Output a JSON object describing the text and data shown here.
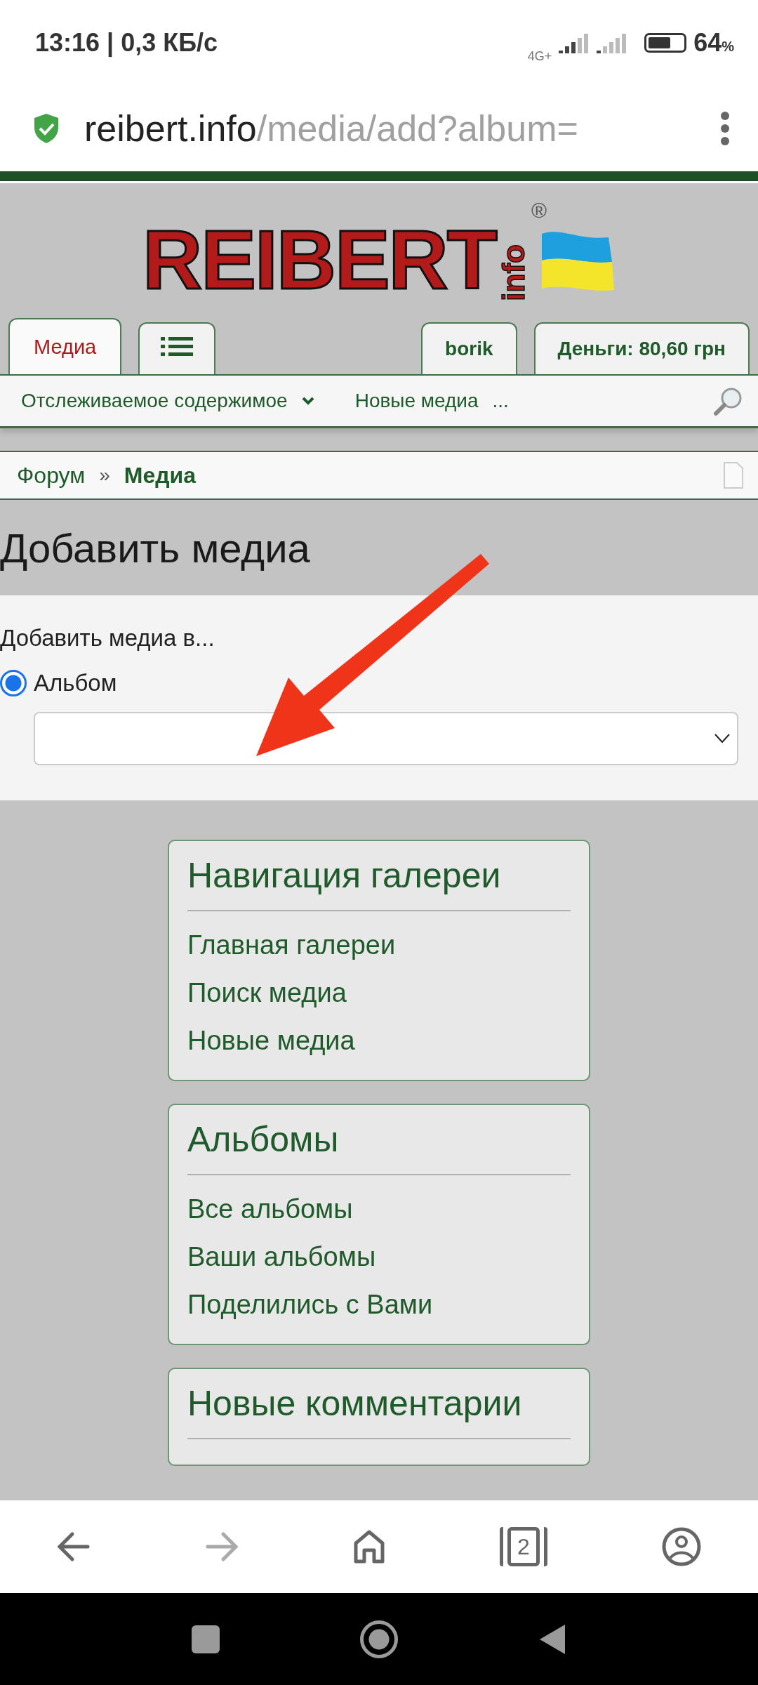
{
  "status_bar": {
    "time": "13:16 | 0,3 КБ/с",
    "network": "4G+",
    "battery": "64",
    "battery_unit": "%"
  },
  "address_bar": {
    "domain": "reibert.info",
    "path": "/media/add?album="
  },
  "logo": {
    "name": "REIBERT",
    "suffix": "info",
    "mark": "®"
  },
  "tabs": [
    {
      "label": "Медиа",
      "kind": "text",
      "selected": true
    },
    {
      "kind": "menu",
      "selected": false
    }
  ],
  "user_tabs": [
    {
      "label": "borik"
    },
    {
      "label": "Деньги: 80,60 грн"
    }
  ],
  "subnav": [
    {
      "label": "Отслеживаемое содержимое",
      "dropdown": true
    },
    {
      "label": "Новые медиа",
      "dropdown": false
    },
    {
      "label": "...",
      "dropdown": false
    }
  ],
  "breadcrumb": [
    {
      "label": "Форум",
      "current": false
    },
    {
      "label": "Медиа",
      "current": true
    }
  ],
  "breadcrumb_separator": "»",
  "page_title": "Добавить медиа",
  "form": {
    "label": "Добавить медиа в...",
    "options": [
      {
        "label": "Альбом",
        "selected": true
      }
    ]
  },
  "cards": [
    {
      "title": "Навигация галереи",
      "links": [
        "Главная галереи",
        "Поиск медиа",
        "Новые медиа"
      ]
    },
    {
      "title": "Альбомы",
      "links": [
        "Все альбомы",
        "Ваши альбомы",
        "Поделились с Вами"
      ]
    },
    {
      "title": "Новые комментарии"
    }
  ],
  "browser_nav": {
    "tab_count": "2",
    "forward_enabled": false
  }
}
